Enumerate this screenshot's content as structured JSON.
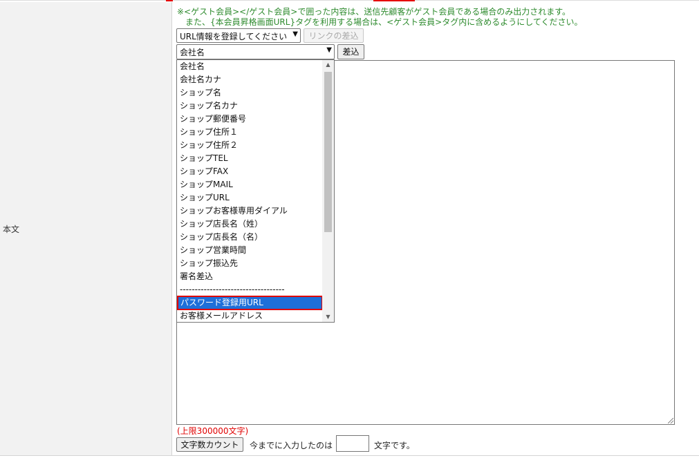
{
  "row_label": "本文",
  "notes": [
    "※<ゲスト会員></ゲスト会員>で囲った内容は、送信先顧客がゲスト会員である場合のみ出力されます。",
    "また、{本会員昇格画面URL}タグを利用する場合は、<ゲスト会員>タグ内に含めるようにしてください。"
  ],
  "url_select": {
    "value": "URL情報を登録してください"
  },
  "link_insert_button": "リンクの差込",
  "field_select": {
    "value": "会社名"
  },
  "insert_button": "差込",
  "dropdown_options": [
    "会社名",
    "会社名カナ",
    "ショップ名",
    "ショップ名カナ",
    "ショップ郵便番号",
    "ショップ住所１",
    "ショップ住所２",
    "ショップTEL",
    "ショップFAX",
    "ショップMAIL",
    "ショップURL",
    "ショップお客様専用ダイアル",
    "ショップ店長名（姓）",
    "ショップ店長名（名）",
    "ショップ営業時間",
    "ショップ振込先",
    "署名差込",
    "-----------------------------------",
    "パスワード登録用URL",
    "お客様メールアドレス"
  ],
  "selected_option": "パスワード登録用URL",
  "limit_text": "(上限300000文字)",
  "count_button": "文字数カウント",
  "count_prefix": "今までに入力したのは",
  "count_value": "",
  "count_suffix": "文字です。",
  "colors": {
    "note": "#2e8b2e",
    "limit": "#e00000",
    "selection": "#1e6fd9",
    "highlight_border": "#e00000"
  }
}
